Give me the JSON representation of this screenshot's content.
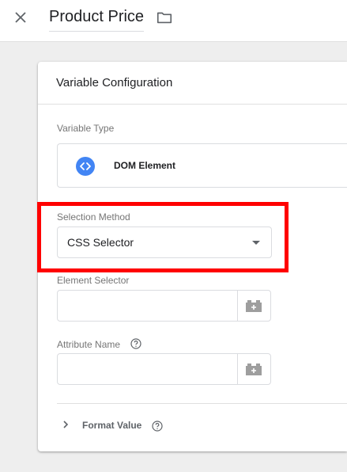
{
  "header": {
    "title": "Product Price"
  },
  "card": {
    "title": "Variable Configuration",
    "variable_type": {
      "label": "Variable Type",
      "name": "DOM Element",
      "icon": "code-brackets-icon",
      "icon_color": "#4285f4"
    },
    "selection_method": {
      "label": "Selection Method",
      "value": "CSS Selector"
    },
    "element_selector": {
      "label": "Element Selector",
      "value": "",
      "placeholder": ""
    },
    "attribute_name": {
      "label": "Attribute Name",
      "value": "",
      "placeholder": ""
    },
    "format_value": {
      "label": "Format Value"
    }
  },
  "colors": {
    "highlight": "#ff0000",
    "accent": "#4285f4"
  }
}
